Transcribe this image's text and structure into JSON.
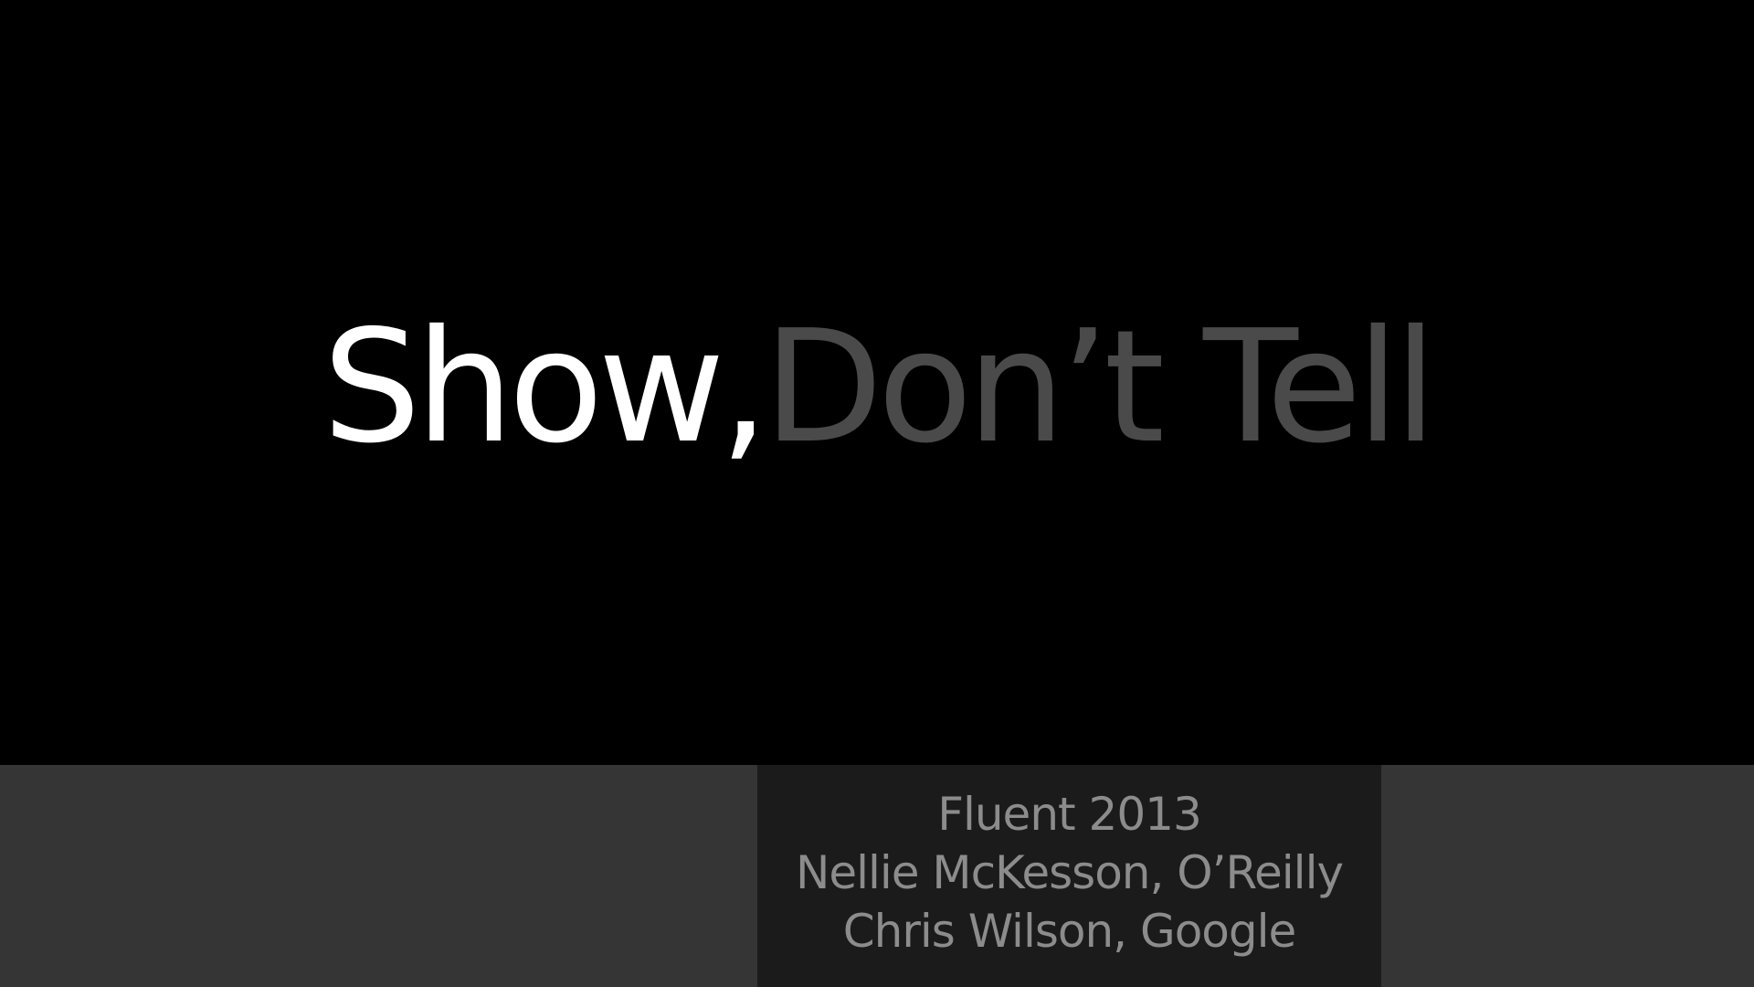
{
  "slide": {
    "title_part1": "Show,",
    "title_part2": "Don’t Tell",
    "credits": [
      "Fluent 2013",
      "Nellie McKesson, O’Reilly",
      "Chris Wilson, Google"
    ]
  },
  "colors": {
    "background": "#000000",
    "title_bright": "#ffffff",
    "title_dim": "#4a4a4a",
    "footer_band": "#353535",
    "credits_box": "#1b1b1b",
    "credits_text": "#8c8c8c"
  }
}
